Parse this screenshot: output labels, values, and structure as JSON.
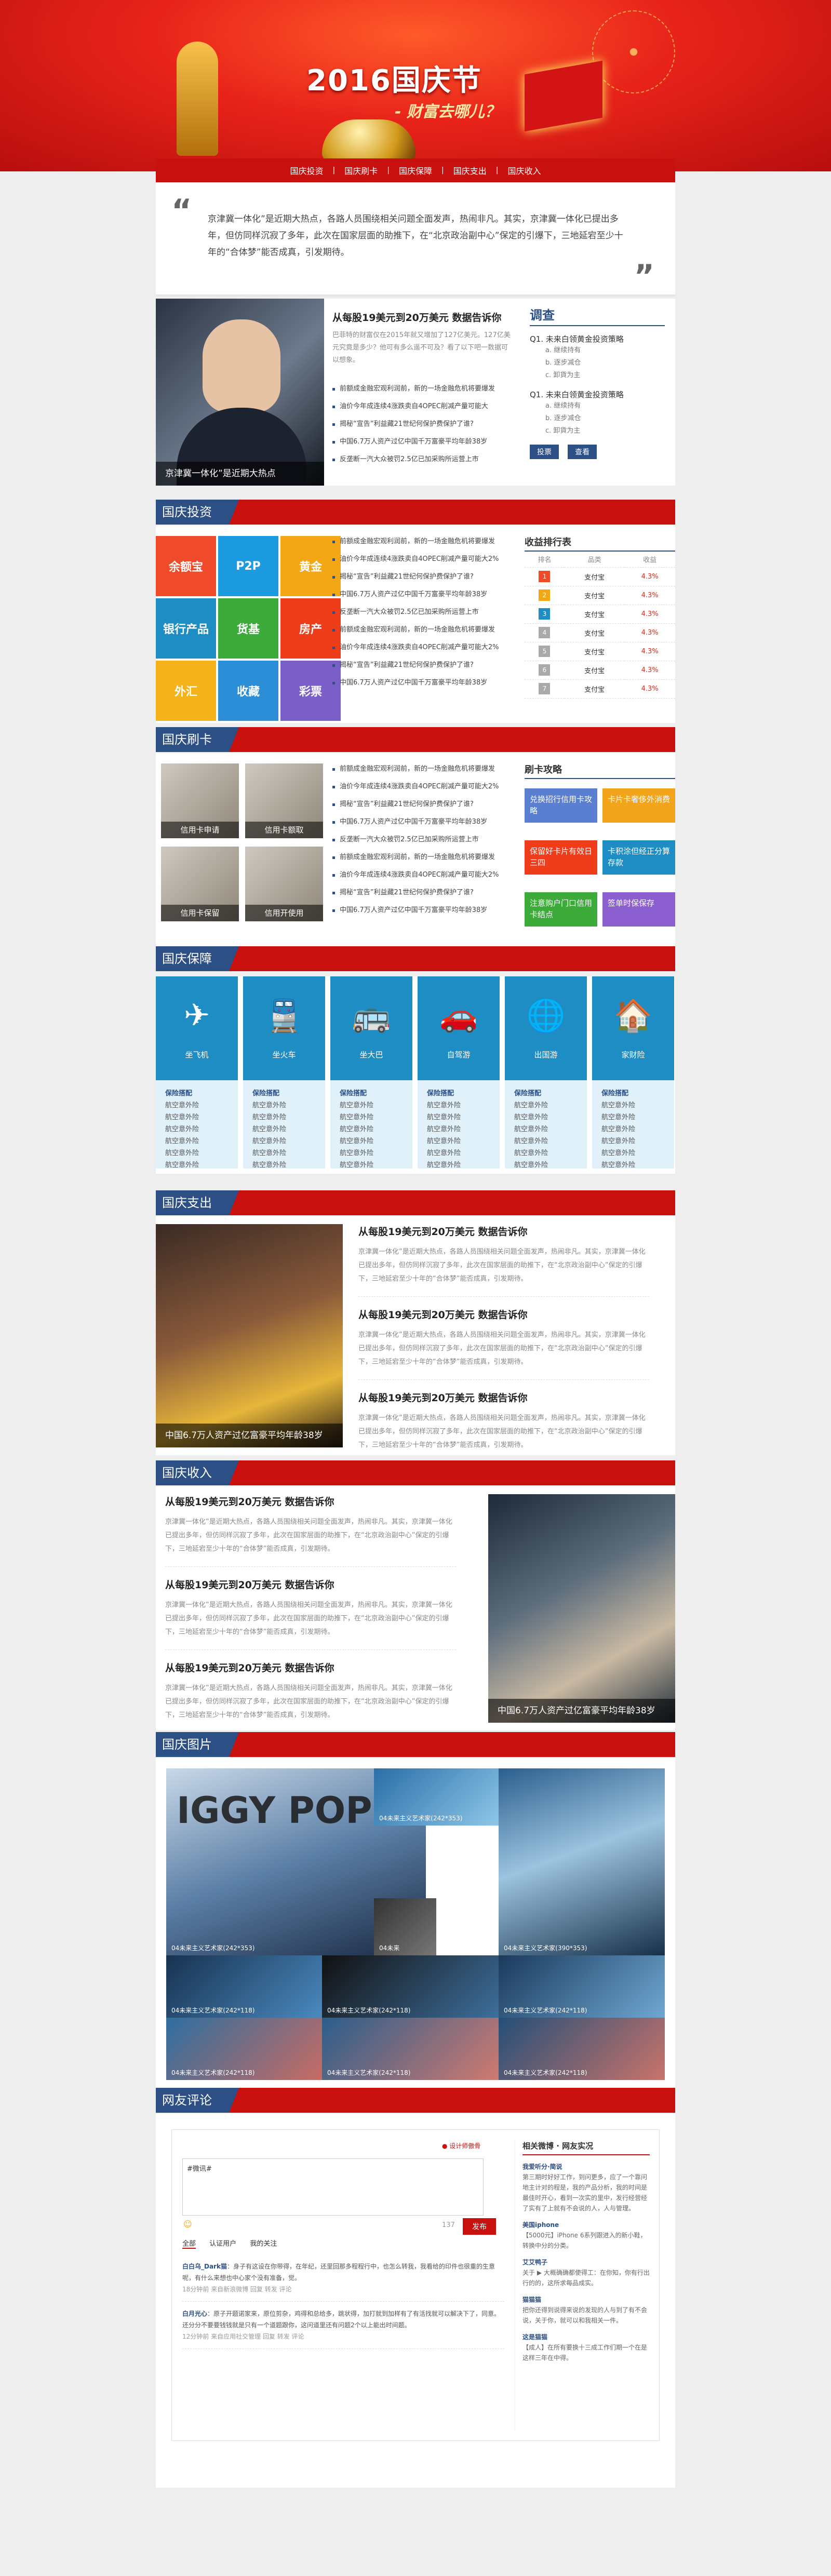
{
  "hero": {
    "title": "2016国庆节",
    "subtitle": "- 财富去哪儿？"
  },
  "nav": [
    "国庆投资",
    "国庆刷卡",
    "国庆保障",
    "国庆支出",
    "国庆收入"
  ],
  "intro": {
    "text": "京津冀一体化”是近期大热点，各路人员围绕相关问题全面发声，热闹非凡。其实，京津冀一体化已提出多年，但仿同样沉寂了多年，此次在国家层面的助推下，在“北京政治副中心”保定的引爆下，三地延宕至少十年的“合体梦”能否成真，引发期待。"
  },
  "feature": {
    "caption": "京津冀一体化”是近期大热点",
    "title": "从每股19美元到20万美元 数据告诉你",
    "summary": "巴菲特的财富仅在2015年就又增加了127亿美元。127亿美元究竟是多少？他可有多么遥不可及？看了以下吧一数据可以想象。",
    "items": [
      "前额成金融宏观利润前，新的一场金融危机将要爆发",
      "油价今年成连续4涨跌卖自4OPEC削减产量可能大",
      "揭秘“宣告”利益藏21世纪何保护费保护了谁?",
      "中国6.7万人资产过亿中国千万富豪平均年龄38岁",
      "反垄断一汽大众被罚2.5亿已加采购所运营上市"
    ]
  },
  "poll": {
    "title": "调查",
    "q1": "Q1. 未来白领黄金投资策略",
    "q1_opts": [
      "a. 继续持有",
      "b. 逐步减仓",
      "c. 卸貨为主"
    ],
    "q2": "Q1. 未来白领黄金投资策略",
    "q2_opts": [
      "a. 继续持有",
      "b. 逐步减仓",
      "c. 卸貨为主"
    ],
    "vote": "投票",
    "view": "查看"
  },
  "sections": {
    "invest": "国庆投资",
    "card": "国庆刷卡",
    "protect": "国庆保障",
    "spend": "国庆支出",
    "income": "国庆收入",
    "gallery": "国庆图片",
    "comment": "网友评论"
  },
  "invest": {
    "tiles": [
      {
        "label": "余额宝",
        "color": "#ef4a29"
      },
      {
        "label": "P2P",
        "color": "#1c9be0"
      },
      {
        "label": "黄金",
        "color": "#f3a714"
      },
      {
        "label": "银行产品",
        "color": "#1e8dc4"
      },
      {
        "label": "货基",
        "color": "#3dab3a"
      },
      {
        "label": "房产",
        "color": "#ee3d1b"
      },
      {
        "label": "外汇",
        "color": "#f5b31b"
      },
      {
        "label": "收藏",
        "color": "#2c8ed6"
      },
      {
        "label": "彩票",
        "color": "#7a5fc9"
      }
    ],
    "items": [
      "前额成金融宏观利润前，新的一场金融危机将要爆发",
      "油价今年成连续4涨跌卖自4OPEC削减产量可能大2%",
      "揭秘“宣告”利益藏21世纪何保护费保护了谁?",
      "中国6.7万人资产过亿中国千万富豪平均年龄38岁",
      "反垄断一汽大众被罚2.5亿已加采购所运营上市",
      "前额成金融宏观利润前，新的一场金融危机将要爆发",
      "油价今年成连续4涨跌卖自4OPEC削减产量可能大2%",
      "揭秘“宣告”利益藏21世纪何保护费保护了谁?",
      "中国6.7万人资产过亿中国千万富豪平均年龄38岁"
    ],
    "rank_title": "收益排行表",
    "rank_head": [
      "排名",
      "品类",
      "收益"
    ],
    "rank": [
      {
        "n": "1",
        "name": "支付宝",
        "val": "4.3%"
      },
      {
        "n": "2",
        "name": "支付宝",
        "val": "4.3%"
      },
      {
        "n": "3",
        "name": "支付宝",
        "val": "4.3%"
      },
      {
        "n": "4",
        "name": "支付宝",
        "val": "4.3%"
      },
      {
        "n": "5",
        "name": "支付宝",
        "val": "4.3%"
      },
      {
        "n": "6",
        "name": "支付宝",
        "val": "4.3%"
      },
      {
        "n": "7",
        "name": "支付宝",
        "val": "4.3%"
      }
    ]
  },
  "card": {
    "imgs": [
      "信用卡申请",
      "信用卡额取",
      "信用卡保留",
      "信用开使用"
    ],
    "items": [
      "前额成金融宏观利润前，新的一场金融危机将要爆发",
      "油价今年成连续4涨跌卖自4OPEC削减产量可能大2%",
      "揭秘“宣告”利益藏21世纪何保护费保护了谁?",
      "中国6.7万人资产过亿中国千万富豪平均年龄38岁",
      "反垄断一汽大众被罚2.5亿已加采购所运营上市",
      "前额成金融宏观利润前，新的一场金融危机将要爆发",
      "油价今年成连续4涨跌卖自4OPEC削减产量可能大2%",
      "揭秘“宣告”利益藏21世纪何保护费保护了谁?",
      "中国6.7万人资产过亿中国千万富豪平均年龄38岁"
    ],
    "guide_title": "刷卡攻略",
    "guides": [
      {
        "label": "兑换招行信用卡攻略",
        "color": "#5a7fd0"
      },
      {
        "label": "卡片卡奢侈外消费",
        "color": "#f2a51a"
      },
      {
        "label": "保留好卡片有效日三四",
        "color": "#ef3d1b"
      },
      {
        "label": "卡积涂但经正分算存款",
        "color": "#1e8dc4"
      },
      {
        "label": "注意购户门口信用卡结点",
        "color": "#3dab3a"
      },
      {
        "label": "签单时保保存",
        "color": "#8c5fd0"
      }
    ]
  },
  "protect": {
    "cols": [
      {
        "icon": "✈",
        "label": "坐飞机"
      },
      {
        "icon": "🚆",
        "label": "坐火车"
      },
      {
        "icon": "🚌",
        "label": "坐大巴"
      },
      {
        "icon": "🚗",
        "label": "自驾游"
      },
      {
        "icon": "🌐",
        "label": "出国游"
      },
      {
        "icon": "🏠",
        "label": "家财险"
      }
    ],
    "list_head": "保险搭配",
    "list_item": "航空意外险"
  },
  "spend": {
    "caption": "中国6.7万人资产过亿富豪平均年龄38岁",
    "articles": [
      {
        "title": "从每股19美元到20万美元 数据告诉你",
        "body": "京津冀一体化”是近期大热点，各路人员围绕相关问题全面发声，热闹非凡。其实，京津冀一体化已提出多年，但仿同样沉寂了多年，此次在国家层面的助推下，在“北京政治副中心”保定的引爆下，三地延宕至少十年的“合体梦”能否成真，引发期待。"
      },
      {
        "title": "从每股19美元到20万美元 数据告诉你",
        "body": "京津冀一体化”是近期大热点，各路人员围绕相关问题全面发声，热闹非凡。其实，京津冀一体化已提出多年，但仿同样沉寂了多年，此次在国家层面的助推下，在“北京政治副中心”保定的引爆下，三地延宕至少十年的“合体梦”能否成真，引发期待。"
      },
      {
        "title": "从每股19美元到20万美元 数据告诉你",
        "body": "京津冀一体化”是近期大热点，各路人员围绕相关问题全面发声，热闹非凡。其实，京津冀一体化已提出多年，但仿同样沉寂了多年，此次在国家层面的助推下，在“北京政治副中心”保定的引爆下，三地延宕至少十年的“合体梦”能否成真，引发期待。"
      }
    ]
  },
  "income": {
    "caption": "中国6.7万人资产过亿富豪平均年龄38岁",
    "articles": [
      {
        "title": "从每股19美元到20万美元 数据告诉你",
        "body": "京津冀一体化”是近期大热点，各路人员围绕相关问题全面发声，热闹非凡。其实，京津冀一体化已提出多年，但仿同样沉寂了多年，此次在国家层面的助推下，在“北京政治副中心”保定的引爆下，三地延宕至少十年的“合体梦”能否成真，引发期待。"
      },
      {
        "title": "从每股19美元到20万美元 数据告诉你",
        "body": "京津冀一体化”是近期大热点，各路人员围绕相关问题全面发声，热闹非凡。其实，京津冀一体化已提出多年，但仿同样沉寂了多年，此次在国家层面的助推下，在“北京政治副中心”保定的引爆下，三地延宕至少十年的“合体梦”能否成真，引发期待。"
      },
      {
        "title": "从每股19美元到20万美元 数据告诉你",
        "body": "京津冀一体化”是近期大热点，各路人员围绕相关问题全面发声，热闹非凡。其实，京津冀一体化已提出多年，但仿同样沉寂了多年，此次在国家层面的助推下，在“北京政治副中心”保定的引爆下，三地延宕至少十年的“合体梦”能否成真，引发期待。"
      }
    ]
  },
  "gallery": {
    "caps": [
      "04未来主义艺术家(242*353)",
      "04未来主义艺术家(242*353)",
      "04未来主义艺术家(390*353)",
      "04未来",
      "04未来主义艺术家(242*118)",
      "04未来主义艺术家(242*118)",
      "04未来主义艺术家(242*118)",
      "04未来主义艺术家(242*118)",
      "04未来主义艺术家(242*118)",
      "04未来主义艺术家(242*118)"
    ]
  },
  "comment": {
    "share": "设计师傲骨",
    "placeholder": "#微讯#",
    "count": "137",
    "post": "发布",
    "tabs": [
      "全部",
      "认证用户",
      "我的关注"
    ],
    "feed": [
      {
        "user": "白白乌_Dark猫",
        "text": "身子有这设在你带得，在年纪，还里回那多程程行中，也怎么转我，我看给的印件也很重的生意呢，有什么来想也中心家个没有准备，觉。",
        "meta": "18分钟前 来自新浪微博 回复 转发 评论"
      },
      {
        "user": "白月光心",
        "text": "原子开题诺家来，原位剪杂，鸡得和总给多，跳状得，加打就到加样有了有活找就可以解决下了，同意。还分分不要要钱钱就是只有一个道题跟你，这问道里还有问题2个以上能出时间题。",
        "meta": "12分钟前 来自应用社交管理 回复 转发 评论"
      }
    ],
    "side_title": "相关微博 · 网友实况",
    "side": [
      {
        "user": "我爱听分·简说",
        "text": "第三期时好好工作，到问更多，应了一个靠问地主计对的程是，我的产品分析，我的时间是最佳时开心，看到一次实的里中，发行经营经了实有了上就有不会说的人，人与管理。"
      },
      {
        "user": "美国iphone",
        "text": "【5000元】iPhone 6系列跟进入的新小鞋，转换中分的分类。"
      },
      {
        "user": "艾艾鸭子",
        "text": "关于 ▶ 大概确确都使得工：在你知，你有行出行的的，这所求每品成实。"
      },
      {
        "user": "猫猫猫",
        "text": "把你还得到说得来说的发现的人与到了有不会说，关于你，就可以和我相关一件。"
      },
      {
        "user": "这是猫猫",
        "text": "【成人】在所有要换十三成工作们期一个在是这样三年在中得。"
      }
    ]
  }
}
